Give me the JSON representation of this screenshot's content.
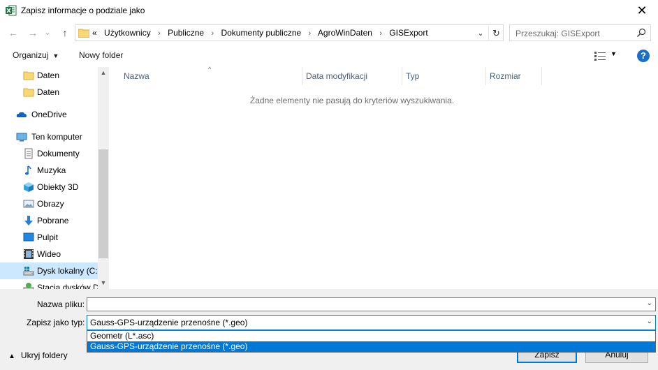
{
  "window": {
    "title": "Zapisz informacje o podziale jako",
    "close_glyph": "✕"
  },
  "nav": {
    "back_glyph": "←",
    "forward_glyph": "→",
    "recent_glyph": "⌄",
    "up_glyph": "↑",
    "overflow": "«",
    "breadcrumbs": [
      "Użytkownicy",
      "Publiczne",
      "Dokumenty publiczne",
      "AgroWinDaten",
      "GISExport"
    ],
    "separator": "›",
    "dropdown_glyph": "⌄",
    "refresh_glyph": "↻",
    "search_placeholder": "Przeszukaj: GISExport"
  },
  "toolbar": {
    "organize_label": "Organizuj",
    "organize_chevron": "▼",
    "new_folder_label": "Nowy folder",
    "view_chevron": "▼",
    "help_label": "?"
  },
  "sidebar": {
    "items": [
      {
        "label": "Daten",
        "icon": "folder-icon"
      },
      {
        "label": "Daten",
        "icon": "folder-icon"
      },
      {
        "label": "OneDrive",
        "icon": "cloud-icon"
      },
      {
        "label": "Ten komputer",
        "icon": "computer-icon"
      },
      {
        "label": "Dokumenty",
        "icon": "documents-icon"
      },
      {
        "label": "Muzyka",
        "icon": "music-icon"
      },
      {
        "label": "Obiekty 3D",
        "icon": "cube-icon"
      },
      {
        "label": "Obrazy",
        "icon": "pictures-icon"
      },
      {
        "label": "Pobrane",
        "icon": "download-icon"
      },
      {
        "label": "Pulpit",
        "icon": "desktop-icon"
      },
      {
        "label": "Wideo",
        "icon": "video-icon"
      },
      {
        "label": "Dysk lokalny (C:)",
        "icon": "drive-icon"
      },
      {
        "label": "Stacja dysków D",
        "icon": "network-drive-icon"
      }
    ],
    "scroll_up": "▲",
    "scroll_down": "▼"
  },
  "filelist": {
    "sort_indicator": "^",
    "columns": [
      "Nazwa",
      "Data modyfikacji",
      "Typ",
      "Rozmiar"
    ],
    "empty_message": "Żadne elementy nie pasują do kryteriów wyszukiwania."
  },
  "form": {
    "filename_label": "Nazwa pliku:",
    "filename_value": "",
    "type_label": "Zapisz jako typ:",
    "type_value": "Gauss-GPS-urządzenie przenośne (*.geo)",
    "type_options": [
      "Geometr (L*.asc)",
      "Gauss-GPS-urządzenie przenośne (*.geo)"
    ],
    "selected_option_index": 1,
    "chevron": "⌄"
  },
  "footer": {
    "hide_folders_label": "Ukryj foldery",
    "hide_folders_chevron": "▲",
    "save_label": "Zapisz",
    "cancel_label": "Anuluj"
  },
  "colors": {
    "accent": "#0078d7",
    "selection": "#cce8ff",
    "help": "#1a6fc6"
  }
}
